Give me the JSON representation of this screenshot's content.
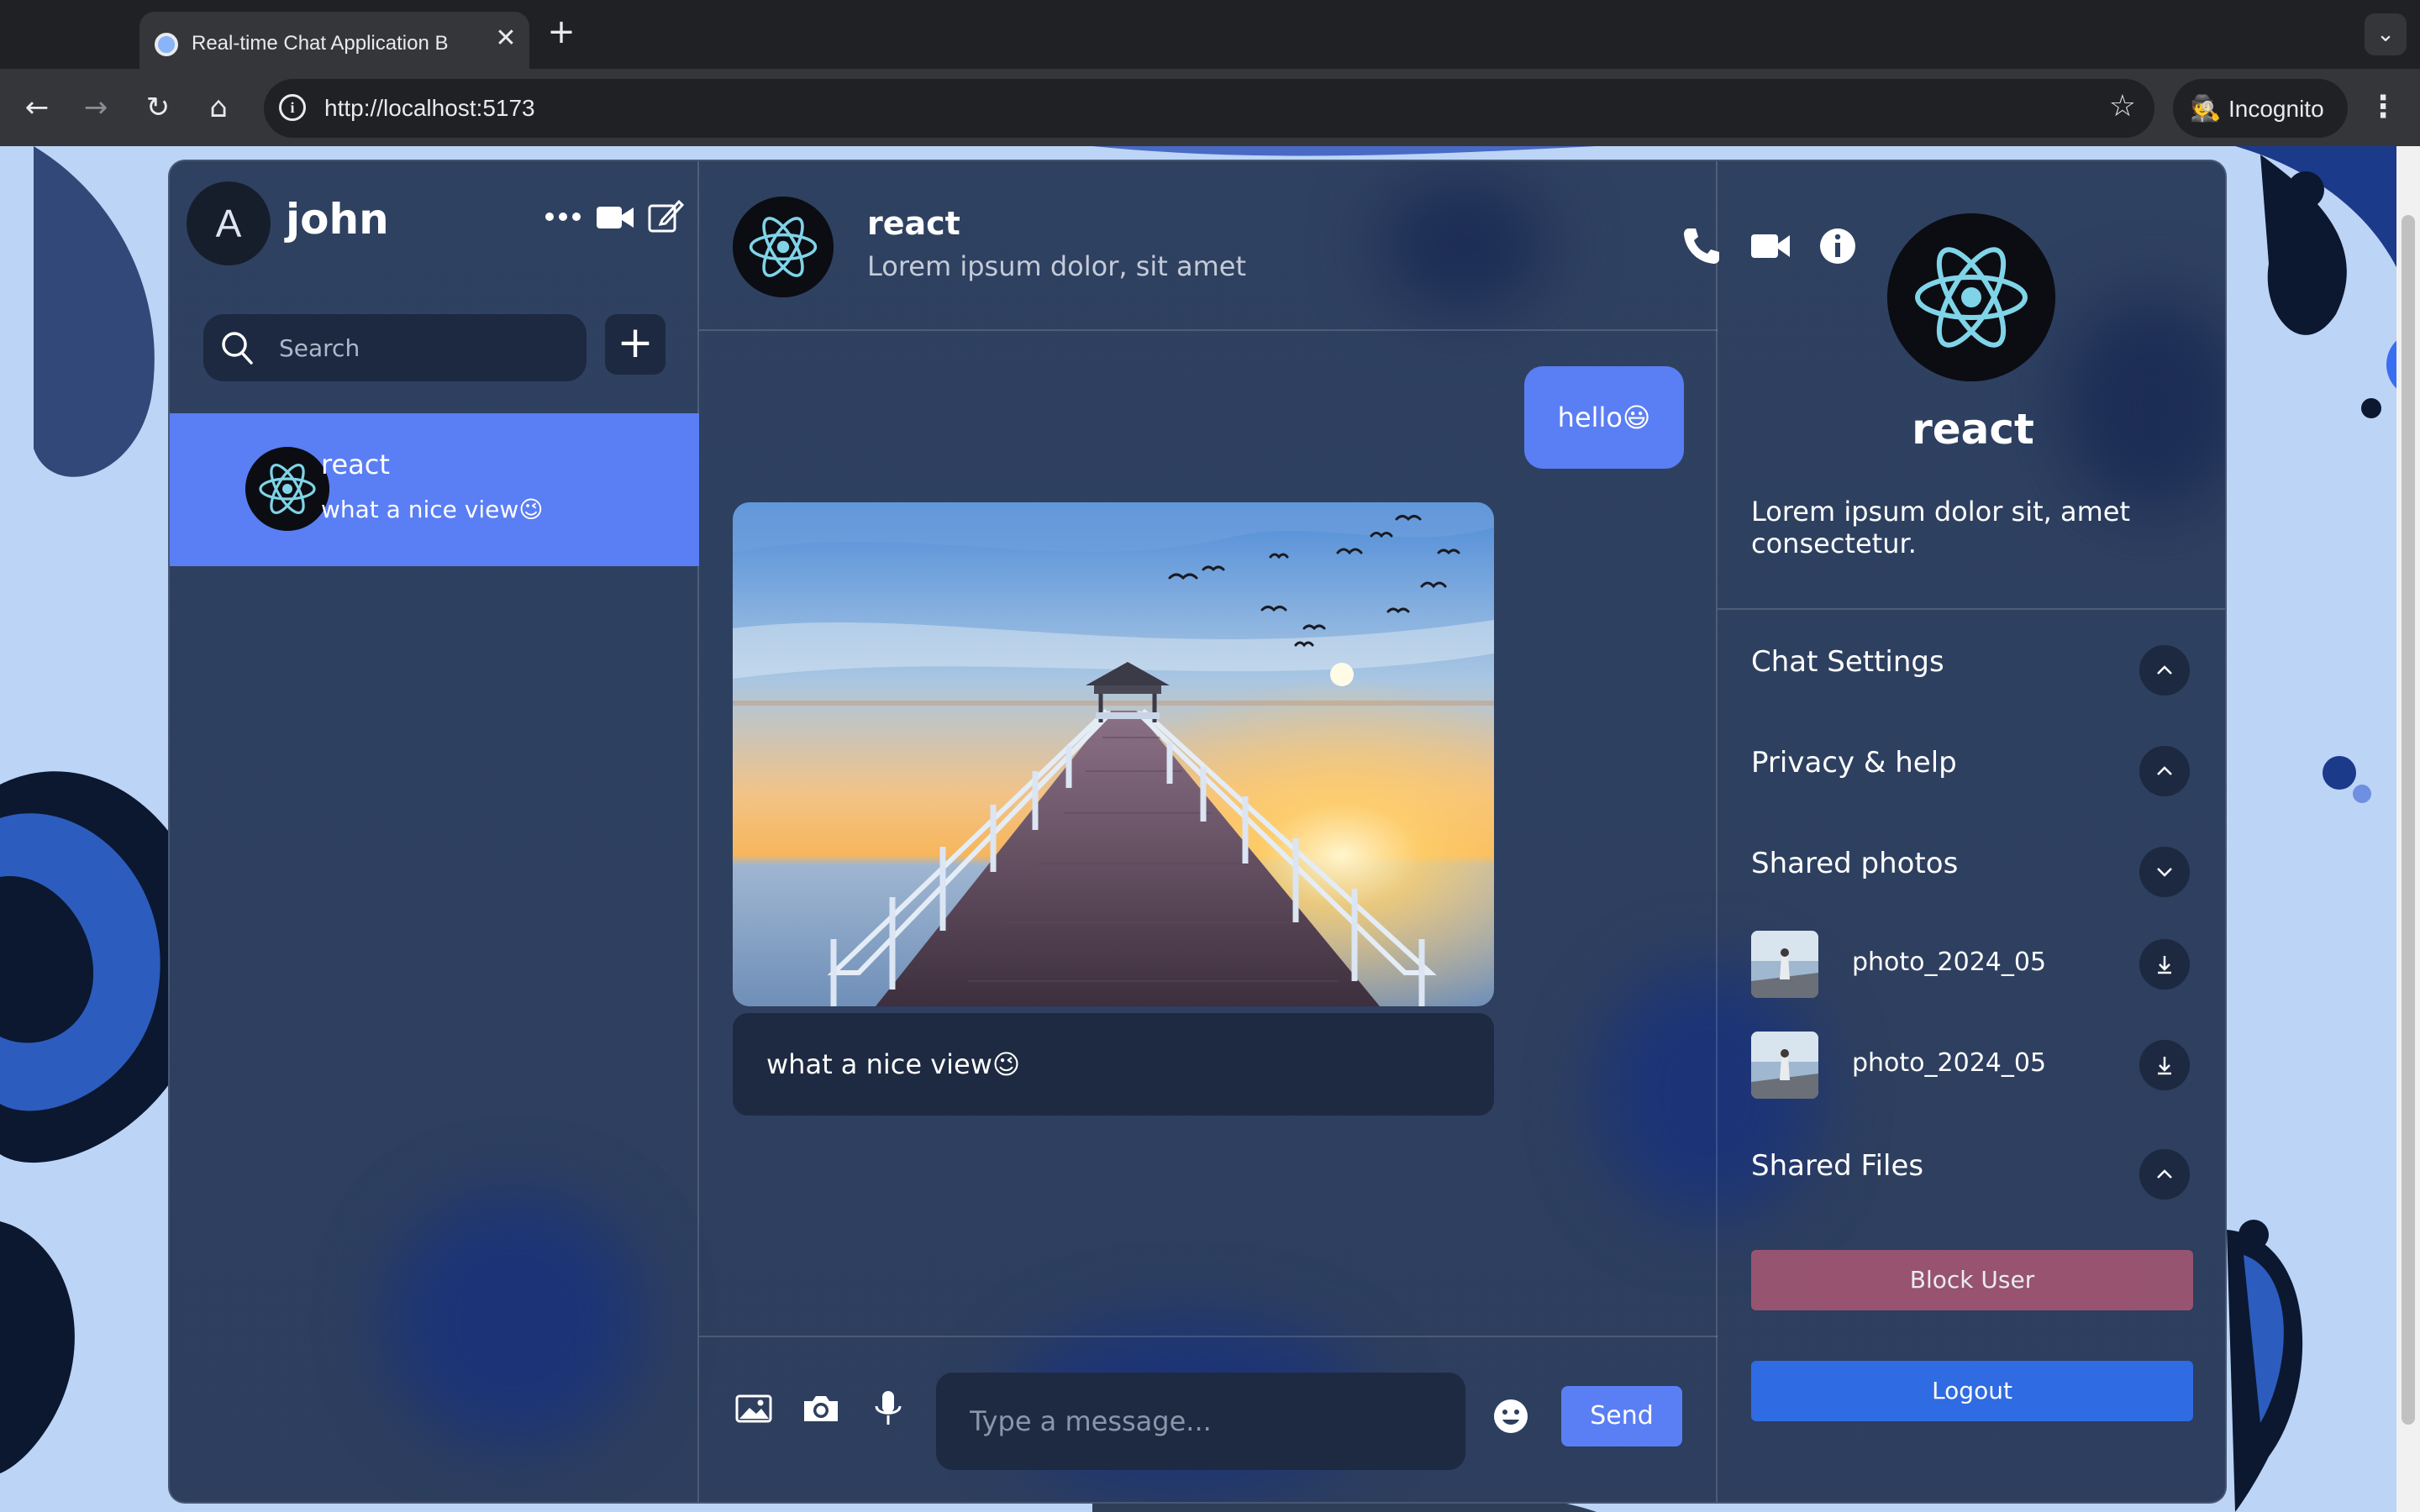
{
  "browser": {
    "tab_title": "Real-time Chat Application B",
    "url": "http://localhost:5173",
    "incognito_label": "Incognito"
  },
  "user": {
    "avatar_letter": "A",
    "name": "john"
  },
  "search": {
    "placeholder": "Search"
  },
  "chat_list": [
    {
      "name": "react",
      "last_message": "what a nice view😉"
    }
  ],
  "chat": {
    "name": "react",
    "description": "Lorem ipsum dolor, sit amet",
    "messages": [
      {
        "own": true,
        "text": "hello😃"
      },
      {
        "own": false,
        "image": "pier-at-sunset",
        "text": "what a nice view😉"
      }
    ],
    "input_placeholder": "Type a message...",
    "send_label": "Send"
  },
  "detail": {
    "name": "react",
    "description": "Lorem ipsum dolor sit, amet consectetur.",
    "options": [
      {
        "title": "Chat Settings",
        "state": "collapsed"
      },
      {
        "title": "Privacy & help",
        "state": "collapsed"
      },
      {
        "title": "Shared photos",
        "state": "expanded"
      },
      {
        "title": "Shared Files",
        "state": "collapsed"
      }
    ],
    "photos": [
      {
        "name": "photo_2024_05"
      },
      {
        "name": "photo_2024_05"
      }
    ],
    "block_label": "Block User",
    "logout_label": "Logout"
  },
  "colors": {
    "accent": "#5a7ef4",
    "panel": "#2f4161",
    "block": "#a35672",
    "logout": "#2f6be2"
  }
}
